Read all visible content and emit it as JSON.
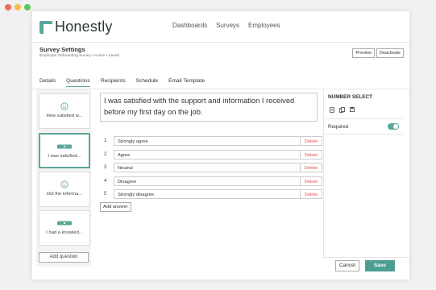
{
  "window": {
    "traffic_lights": {
      "red": "#f26b5f",
      "yellow": "#f6be4f",
      "green": "#5dc85a"
    }
  },
  "brand": {
    "name": "Honestly",
    "accent": "#5aa89c"
  },
  "nav": [
    "Dashboards",
    "Surveys",
    "Employees"
  ],
  "header": {
    "title": "Survey Settings",
    "meta": "Employee Onboarding Survey  •  Active  •  Saved",
    "preview": "Preview",
    "deactivate": "Deactivate"
  },
  "tabs": [
    "Details",
    "Questions",
    "Recipients",
    "Schedule",
    "Email Template"
  ],
  "active_tab": "Questions",
  "questions": [
    {
      "label": "How satisfied w...",
      "icon": "smiley-icon"
    },
    {
      "label": "I was satisfied...",
      "icon": "number-select-icon",
      "selected": true
    },
    {
      "label": "Did the informa...",
      "icon": "smiley-icon"
    },
    {
      "label": "I had a knowled...",
      "icon": "number-select-icon"
    }
  ],
  "add_question": "Add question",
  "question_text": "I was satisfied with the support and information I received before my first day on the job.",
  "answers": [
    {
      "num": "1",
      "text": "Strongly agree",
      "delete": "Delete"
    },
    {
      "num": "2",
      "text": "Agree",
      "delete": "Delete"
    },
    {
      "num": "3",
      "text": "Neutral",
      "delete": "Delete"
    },
    {
      "num": "4",
      "text": "Disagree",
      "delete": "Delete"
    },
    {
      "num": "5",
      "text": "Strongly disagree",
      "delete": "Delete"
    }
  ],
  "add_answer": "Add answer",
  "side_panel": {
    "title": "NUMBER SELECT",
    "icons": [
      "copy-icon",
      "duplicate-icon",
      "save-icon"
    ],
    "required_label": "Required",
    "required": true
  },
  "footer": {
    "cancel": "Cancel",
    "save": "Save"
  }
}
